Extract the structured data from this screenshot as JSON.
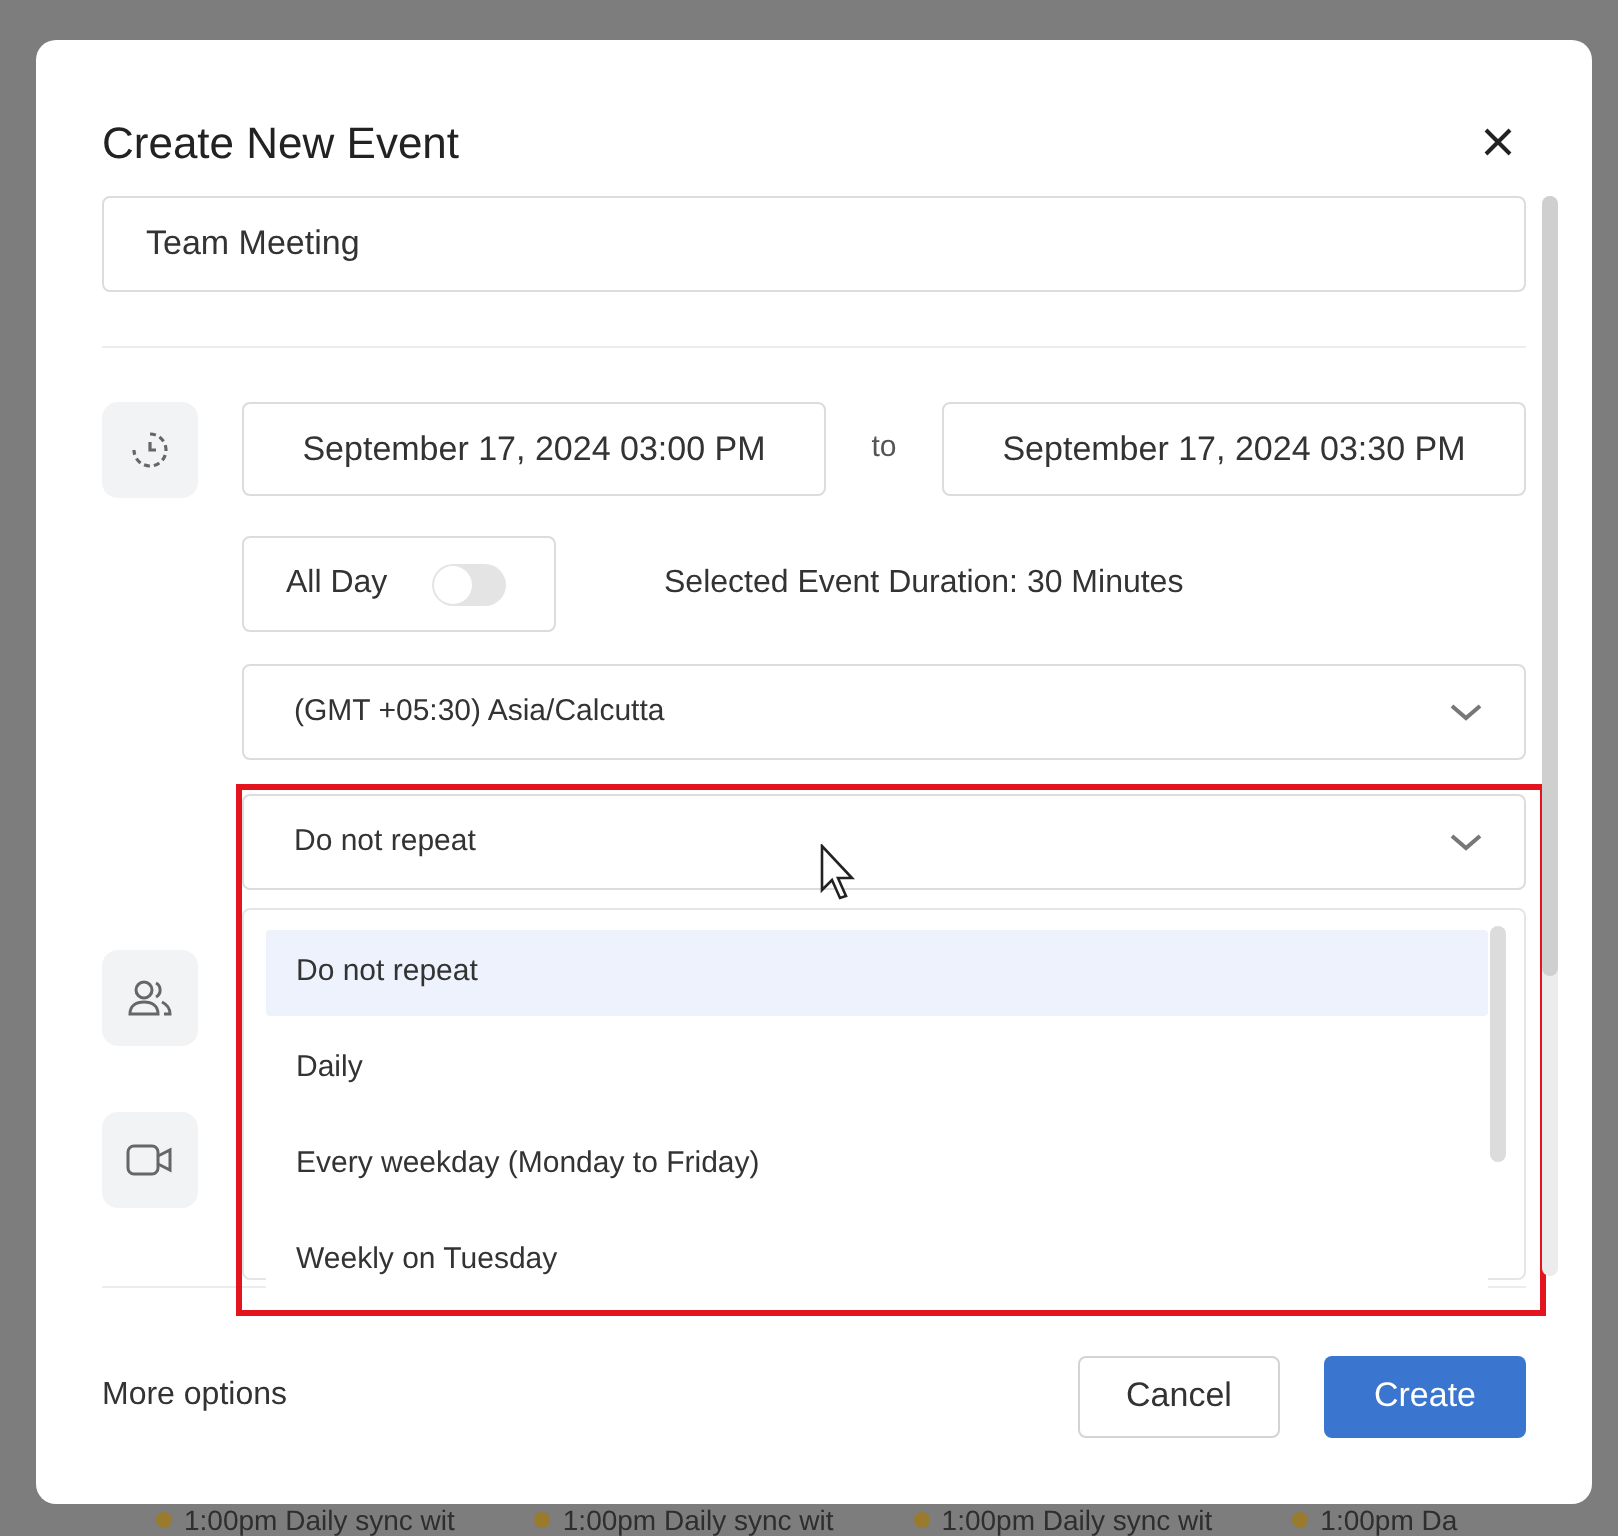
{
  "background_events": [
    {
      "time": "1:00pm",
      "title": "Daily sync wit"
    },
    {
      "time": "1:00pm",
      "title": "Daily sync wit"
    },
    {
      "time": "1:00pm",
      "title": "Daily sync wit"
    },
    {
      "time": "1:00pm",
      "title": "Da"
    }
  ],
  "dialog": {
    "title": "Create New Event",
    "event_title": "Team Meeting",
    "start": "September 17, 2024 03:00 PM",
    "to": "to",
    "end": "September 17, 2024 03:30 PM",
    "all_day": {
      "label": "All Day",
      "on": false
    },
    "duration": "Selected Event Duration: 30 Minutes",
    "timezone": "(GMT +05:30) Asia/Calcutta",
    "repeat": {
      "value": "Do not repeat",
      "expanded": true,
      "highlighted": true,
      "options": [
        {
          "label": "Do not repeat",
          "selected": true
        },
        {
          "label": "Daily",
          "selected": false
        },
        {
          "label": "Every weekday (Monday to Friday)",
          "selected": false
        },
        {
          "label": "Weekly on Tuesday",
          "selected": false
        }
      ]
    },
    "more_options": "More options",
    "buttons": [
      {
        "label": "Cancel",
        "kind": "secondary"
      },
      {
        "label": "Create",
        "kind": "primary"
      }
    ]
  }
}
